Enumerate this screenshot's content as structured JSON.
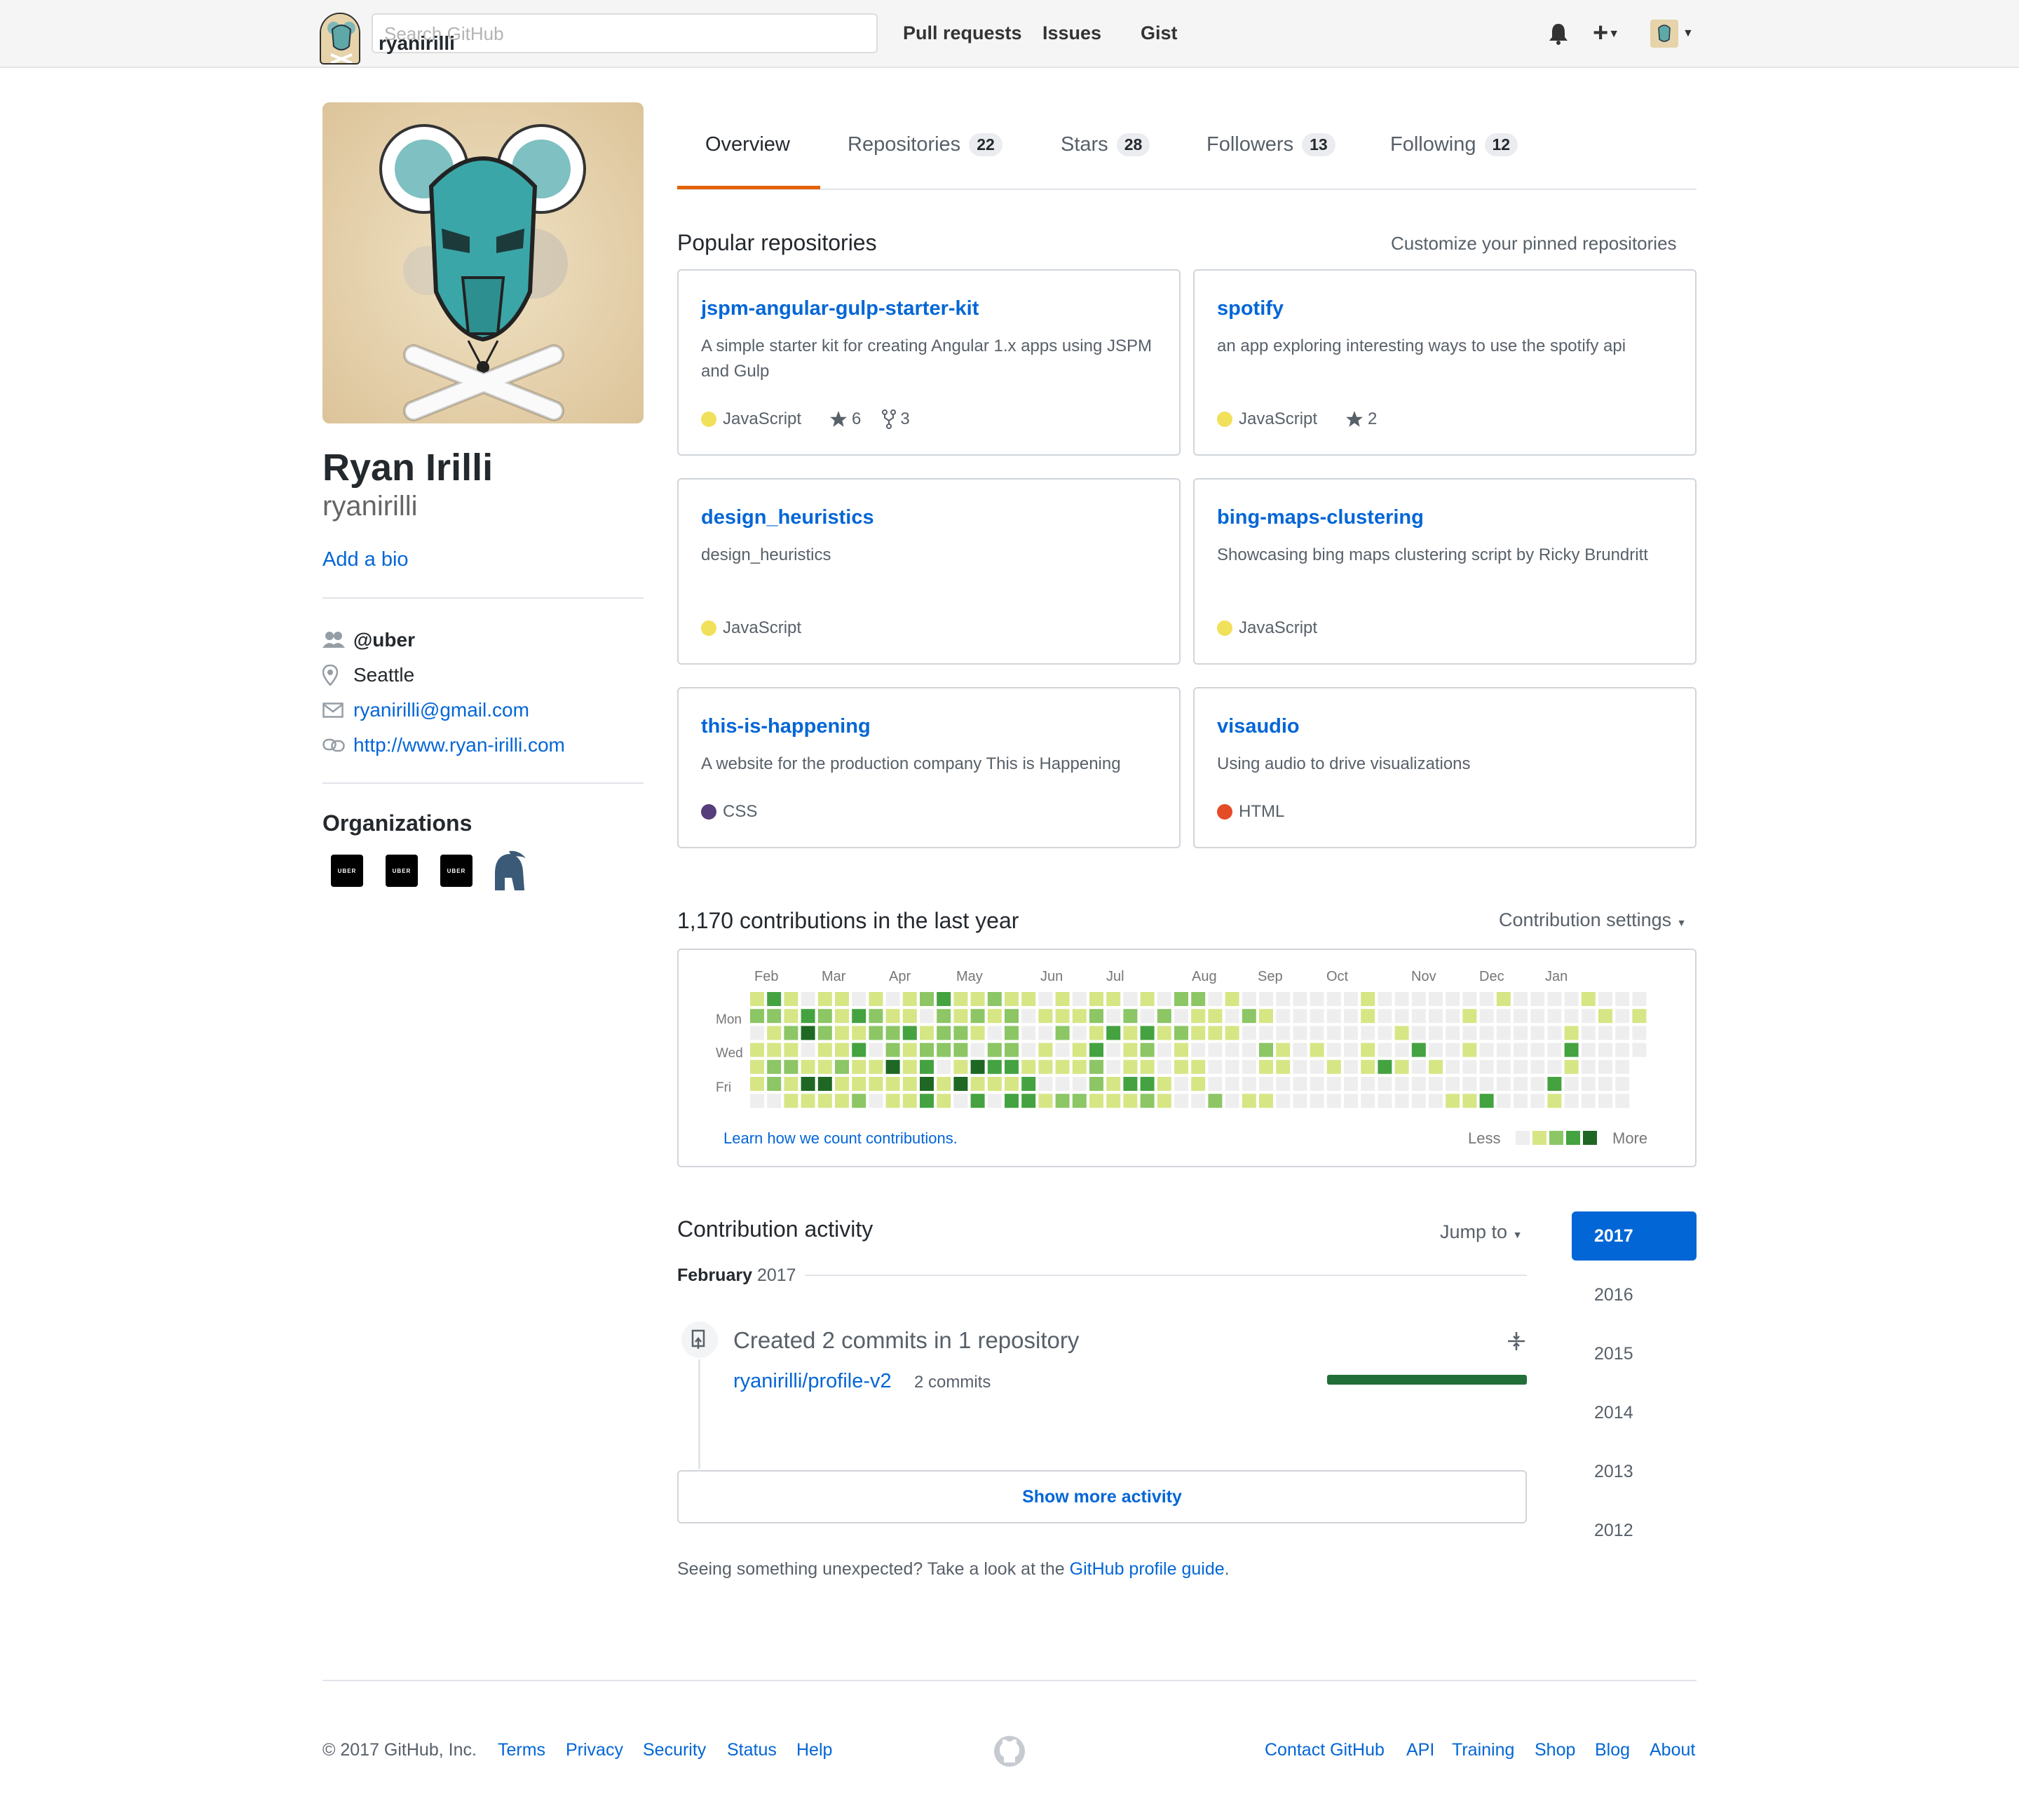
{
  "header": {
    "search_placeholder": "Search GitHub",
    "username_overlay": "ryanirilli",
    "nav": [
      "Pull requests",
      "Issues",
      "Gist"
    ],
    "plus_label": "+"
  },
  "profile": {
    "full_name": "Ryan Irilli",
    "username": "ryanirilli",
    "add_bio": "Add a bio",
    "company": "@uber",
    "location": "Seattle",
    "email": "ryanirilli@gmail.com",
    "website": "http://www.ryan-irilli.com",
    "organizations_title": "Organizations",
    "org_badge_text": "UBER"
  },
  "tabs": [
    {
      "label": "Overview",
      "count": ""
    },
    {
      "label": "Repositories",
      "count": "22"
    },
    {
      "label": "Stars",
      "count": "28"
    },
    {
      "label": "Followers",
      "count": "13"
    },
    {
      "label": "Following",
      "count": "12"
    }
  ],
  "pinned": {
    "title": "Popular repositories",
    "customize": "Customize your pinned repositories",
    "repos": [
      {
        "name": "jspm-angular-gulp-starter-kit",
        "desc": "A simple starter kit for creating Angular 1.x apps using JSPM and Gulp",
        "lang": "JavaScript",
        "lang_color": "#f1e05a",
        "stars": "6",
        "forks": "3"
      },
      {
        "name": "spotify",
        "desc": "an app exploring interesting ways to use the spotify api",
        "lang": "JavaScript",
        "lang_color": "#f1e05a",
        "stars": "2",
        "forks": ""
      },
      {
        "name": "design_heuristics",
        "desc": "design_heuristics",
        "lang": "JavaScript",
        "lang_color": "#f1e05a",
        "stars": "",
        "forks": ""
      },
      {
        "name": "bing-maps-clustering",
        "desc": "Showcasing bing maps clustering script by Ricky Brundritt",
        "lang": "JavaScript",
        "lang_color": "#f1e05a",
        "stars": "",
        "forks": ""
      },
      {
        "name": "this-is-happening",
        "desc": "A website for the production company This is Happening",
        "lang": "CSS",
        "lang_color": "#563d7c",
        "stars": "",
        "forks": ""
      },
      {
        "name": "visaudio",
        "desc": "Using audio to drive visualizations",
        "lang": "HTML",
        "lang_color": "#e34c26",
        "stars": "",
        "forks": ""
      }
    ]
  },
  "contributions": {
    "title": "1,170 contributions in the last year",
    "settings": "Contribution settings",
    "months": [
      "Feb",
      "Mar",
      "Apr",
      "May",
      "Jun",
      "Jul",
      "Aug",
      "Sep",
      "Oct",
      "Nov",
      "Dec",
      "Jan"
    ],
    "days": [
      "Mon",
      "Wed",
      "Fri"
    ],
    "learn": "Learn how we count contributions.",
    "less": "Less",
    "more": "More",
    "level_colors": [
      "#eeeeee",
      "#d6e685",
      "#8cc665",
      "#44a340",
      "#1e6823"
    ]
  },
  "activity": {
    "title": "Contribution activity",
    "jump_to": "Jump to",
    "years": [
      "2017",
      "2016",
      "2015",
      "2014",
      "2013",
      "2012"
    ],
    "month": "February",
    "month_year": "2017",
    "commit_title": "Created 2 commits in 1 repository",
    "commit_repo": "ryanirilli/profile-v2",
    "commit_count": "2 commits",
    "show_more": "Show more activity",
    "unexpected": "Seeing something unexpected? Take a look at the",
    "guide_link": "GitHub profile guide",
    "period": "."
  },
  "footer": {
    "copyright": "© 2017 GitHub, Inc.",
    "left_links": [
      "Terms",
      "Privacy",
      "Security",
      "Status",
      "Help"
    ],
    "right_links": [
      "Contact GitHub",
      "API",
      "Training",
      "Shop",
      "Blog",
      "About"
    ]
  }
}
